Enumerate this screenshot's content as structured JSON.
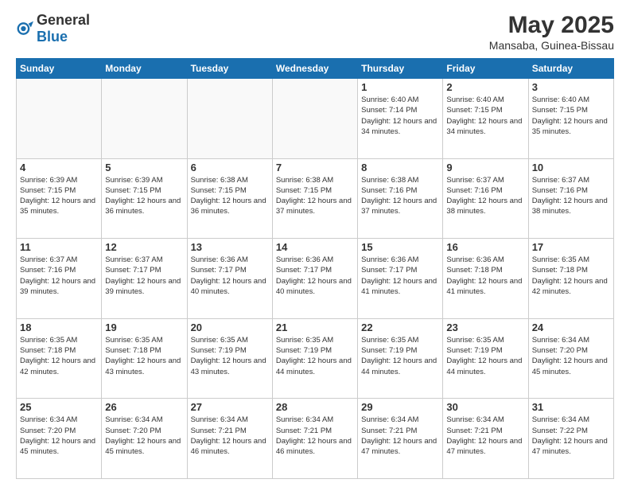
{
  "header": {
    "logo": {
      "general": "General",
      "blue": "Blue"
    },
    "title": "May 2025",
    "location": "Mansaba, Guinea-Bissau"
  },
  "weekdays": [
    "Sunday",
    "Monday",
    "Tuesday",
    "Wednesday",
    "Thursday",
    "Friday",
    "Saturday"
  ],
  "weeks": [
    [
      {
        "day": "",
        "sunrise": "",
        "sunset": "",
        "daylight": "",
        "empty": true
      },
      {
        "day": "",
        "sunrise": "",
        "sunset": "",
        "daylight": "",
        "empty": true
      },
      {
        "day": "",
        "sunrise": "",
        "sunset": "",
        "daylight": "",
        "empty": true
      },
      {
        "day": "",
        "sunrise": "",
        "sunset": "",
        "daylight": "",
        "empty": true
      },
      {
        "day": "1",
        "sunrise": "Sunrise: 6:40 AM",
        "sunset": "Sunset: 7:14 PM",
        "daylight": "Daylight: 12 hours and 34 minutes.",
        "empty": false
      },
      {
        "day": "2",
        "sunrise": "Sunrise: 6:40 AM",
        "sunset": "Sunset: 7:15 PM",
        "daylight": "Daylight: 12 hours and 34 minutes.",
        "empty": false
      },
      {
        "day": "3",
        "sunrise": "Sunrise: 6:40 AM",
        "sunset": "Sunset: 7:15 PM",
        "daylight": "Daylight: 12 hours and 35 minutes.",
        "empty": false
      }
    ],
    [
      {
        "day": "4",
        "sunrise": "Sunrise: 6:39 AM",
        "sunset": "Sunset: 7:15 PM",
        "daylight": "Daylight: 12 hours and 35 minutes.",
        "empty": false
      },
      {
        "day": "5",
        "sunrise": "Sunrise: 6:39 AM",
        "sunset": "Sunset: 7:15 PM",
        "daylight": "Daylight: 12 hours and 36 minutes.",
        "empty": false
      },
      {
        "day": "6",
        "sunrise": "Sunrise: 6:38 AM",
        "sunset": "Sunset: 7:15 PM",
        "daylight": "Daylight: 12 hours and 36 minutes.",
        "empty": false
      },
      {
        "day": "7",
        "sunrise": "Sunrise: 6:38 AM",
        "sunset": "Sunset: 7:15 PM",
        "daylight": "Daylight: 12 hours and 37 minutes.",
        "empty": false
      },
      {
        "day": "8",
        "sunrise": "Sunrise: 6:38 AM",
        "sunset": "Sunset: 7:16 PM",
        "daylight": "Daylight: 12 hours and 37 minutes.",
        "empty": false
      },
      {
        "day": "9",
        "sunrise": "Sunrise: 6:37 AM",
        "sunset": "Sunset: 7:16 PM",
        "daylight": "Daylight: 12 hours and 38 minutes.",
        "empty": false
      },
      {
        "day": "10",
        "sunrise": "Sunrise: 6:37 AM",
        "sunset": "Sunset: 7:16 PM",
        "daylight": "Daylight: 12 hours and 38 minutes.",
        "empty": false
      }
    ],
    [
      {
        "day": "11",
        "sunrise": "Sunrise: 6:37 AM",
        "sunset": "Sunset: 7:16 PM",
        "daylight": "Daylight: 12 hours and 39 minutes.",
        "empty": false
      },
      {
        "day": "12",
        "sunrise": "Sunrise: 6:37 AM",
        "sunset": "Sunset: 7:17 PM",
        "daylight": "Daylight: 12 hours and 39 minutes.",
        "empty": false
      },
      {
        "day": "13",
        "sunrise": "Sunrise: 6:36 AM",
        "sunset": "Sunset: 7:17 PM",
        "daylight": "Daylight: 12 hours and 40 minutes.",
        "empty": false
      },
      {
        "day": "14",
        "sunrise": "Sunrise: 6:36 AM",
        "sunset": "Sunset: 7:17 PM",
        "daylight": "Daylight: 12 hours and 40 minutes.",
        "empty": false
      },
      {
        "day": "15",
        "sunrise": "Sunrise: 6:36 AM",
        "sunset": "Sunset: 7:17 PM",
        "daylight": "Daylight: 12 hours and 41 minutes.",
        "empty": false
      },
      {
        "day": "16",
        "sunrise": "Sunrise: 6:36 AM",
        "sunset": "Sunset: 7:18 PM",
        "daylight": "Daylight: 12 hours and 41 minutes.",
        "empty": false
      },
      {
        "day": "17",
        "sunrise": "Sunrise: 6:35 AM",
        "sunset": "Sunset: 7:18 PM",
        "daylight": "Daylight: 12 hours and 42 minutes.",
        "empty": false
      }
    ],
    [
      {
        "day": "18",
        "sunrise": "Sunrise: 6:35 AM",
        "sunset": "Sunset: 7:18 PM",
        "daylight": "Daylight: 12 hours and 42 minutes.",
        "empty": false
      },
      {
        "day": "19",
        "sunrise": "Sunrise: 6:35 AM",
        "sunset": "Sunset: 7:18 PM",
        "daylight": "Daylight: 12 hours and 43 minutes.",
        "empty": false
      },
      {
        "day": "20",
        "sunrise": "Sunrise: 6:35 AM",
        "sunset": "Sunset: 7:19 PM",
        "daylight": "Daylight: 12 hours and 43 minutes.",
        "empty": false
      },
      {
        "day": "21",
        "sunrise": "Sunrise: 6:35 AM",
        "sunset": "Sunset: 7:19 PM",
        "daylight": "Daylight: 12 hours and 44 minutes.",
        "empty": false
      },
      {
        "day": "22",
        "sunrise": "Sunrise: 6:35 AM",
        "sunset": "Sunset: 7:19 PM",
        "daylight": "Daylight: 12 hours and 44 minutes.",
        "empty": false
      },
      {
        "day": "23",
        "sunrise": "Sunrise: 6:35 AM",
        "sunset": "Sunset: 7:19 PM",
        "daylight": "Daylight: 12 hours and 44 minutes.",
        "empty": false
      },
      {
        "day": "24",
        "sunrise": "Sunrise: 6:34 AM",
        "sunset": "Sunset: 7:20 PM",
        "daylight": "Daylight: 12 hours and 45 minutes.",
        "empty": false
      }
    ],
    [
      {
        "day": "25",
        "sunrise": "Sunrise: 6:34 AM",
        "sunset": "Sunset: 7:20 PM",
        "daylight": "Daylight: 12 hours and 45 minutes.",
        "empty": false
      },
      {
        "day": "26",
        "sunrise": "Sunrise: 6:34 AM",
        "sunset": "Sunset: 7:20 PM",
        "daylight": "Daylight: 12 hours and 45 minutes.",
        "empty": false
      },
      {
        "day": "27",
        "sunrise": "Sunrise: 6:34 AM",
        "sunset": "Sunset: 7:21 PM",
        "daylight": "Daylight: 12 hours and 46 minutes.",
        "empty": false
      },
      {
        "day": "28",
        "sunrise": "Sunrise: 6:34 AM",
        "sunset": "Sunset: 7:21 PM",
        "daylight": "Daylight: 12 hours and 46 minutes.",
        "empty": false
      },
      {
        "day": "29",
        "sunrise": "Sunrise: 6:34 AM",
        "sunset": "Sunset: 7:21 PM",
        "daylight": "Daylight: 12 hours and 47 minutes.",
        "empty": false
      },
      {
        "day": "30",
        "sunrise": "Sunrise: 6:34 AM",
        "sunset": "Sunset: 7:21 PM",
        "daylight": "Daylight: 12 hours and 47 minutes.",
        "empty": false
      },
      {
        "day": "31",
        "sunrise": "Sunrise: 6:34 AM",
        "sunset": "Sunset: 7:22 PM",
        "daylight": "Daylight: 12 hours and 47 minutes.",
        "empty": false
      }
    ]
  ]
}
